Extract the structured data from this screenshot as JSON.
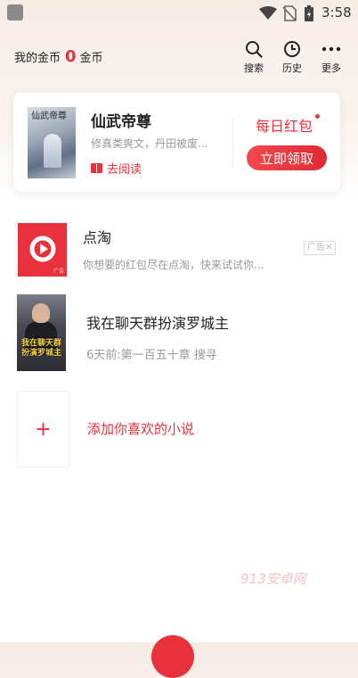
{
  "status_bar": {
    "time": "3:58"
  },
  "header": {
    "coins_label": "我的金币",
    "coins_value": "0",
    "coins_unit": "金币",
    "actions": [
      {
        "label": "搜索",
        "icon": "search-icon"
      },
      {
        "label": "历史",
        "icon": "clock-icon"
      },
      {
        "label": "更多",
        "icon": "more-dots-icon"
      }
    ]
  },
  "featured": {
    "cover_title": "仙武帝尊",
    "title": "仙武帝尊",
    "description": "修真类爽文，丹田被废...",
    "read_label": "去阅读",
    "daily_label": "每日红包",
    "claim_label": "立即领取"
  },
  "ad": {
    "name": "点淘",
    "description": "你想要的红包尽在点淘，快来试试你...",
    "tag": "广告",
    "tag_close": "✕",
    "logo_small": "广告"
  },
  "books": [
    {
      "cover_text": "我在聊天群扮演罗城主",
      "title": "我在聊天群扮演罗城主",
      "meta": "6天前:第一百五十章 搜寻"
    }
  ],
  "add": {
    "plus": "+",
    "label": "添加你喜欢的小说"
  },
  "watermark": "913安卓网",
  "colors": {
    "accent": "#e8313d"
  }
}
